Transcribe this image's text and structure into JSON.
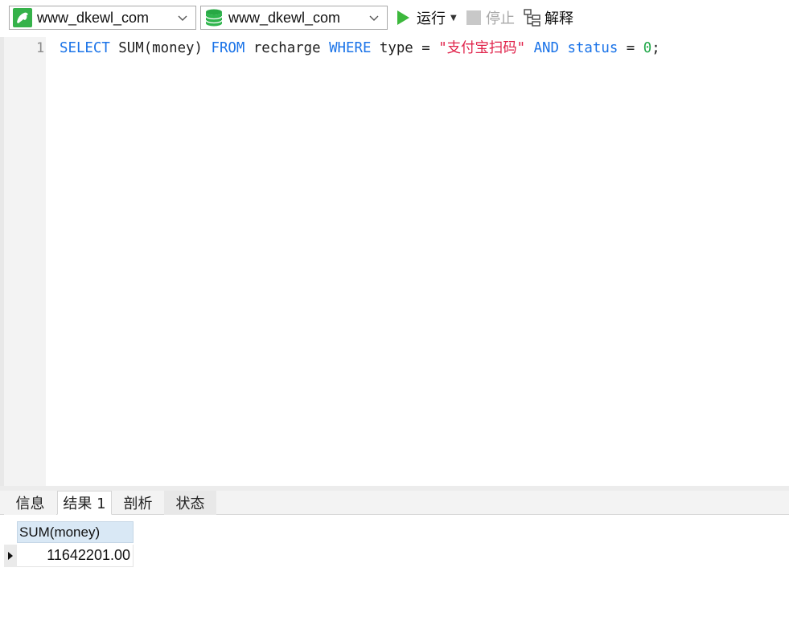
{
  "toolbar": {
    "connection": {
      "value": "www_dkewl_com",
      "icon": "mysql-dolphin-icon"
    },
    "database": {
      "value": "www_dkewl_com",
      "icon": "database-icon"
    },
    "run_label": "运行",
    "stop_label": "停止",
    "explain_label": "解释"
  },
  "editor": {
    "line_number": "1",
    "tokens": {
      "t1": "SELECT",
      "t2": " SUM(money) ",
      "t3": "FROM",
      "t4": " recharge ",
      "t5": "WHERE",
      "t6": " type = ",
      "t7": "\"支付宝扫码\"",
      "t8": " ",
      "t9": "AND",
      "t10": " ",
      "t11": "status",
      "t12": " = ",
      "t13": "0",
      "t14": ";"
    }
  },
  "tabs": [
    {
      "label": "信息"
    },
    {
      "label": "结果 1",
      "active": true
    },
    {
      "label": "剖析"
    },
    {
      "label": "状态"
    }
  ],
  "result": {
    "columns": [
      "SUM(money)"
    ],
    "rows": [
      [
        "11642201.00"
      ]
    ]
  },
  "colors": {
    "keyword": "#1a73e8",
    "string": "#e0224a",
    "number": "#22a84a",
    "run_green": "#3cb83c",
    "header_bg": "#d9e8f5"
  }
}
